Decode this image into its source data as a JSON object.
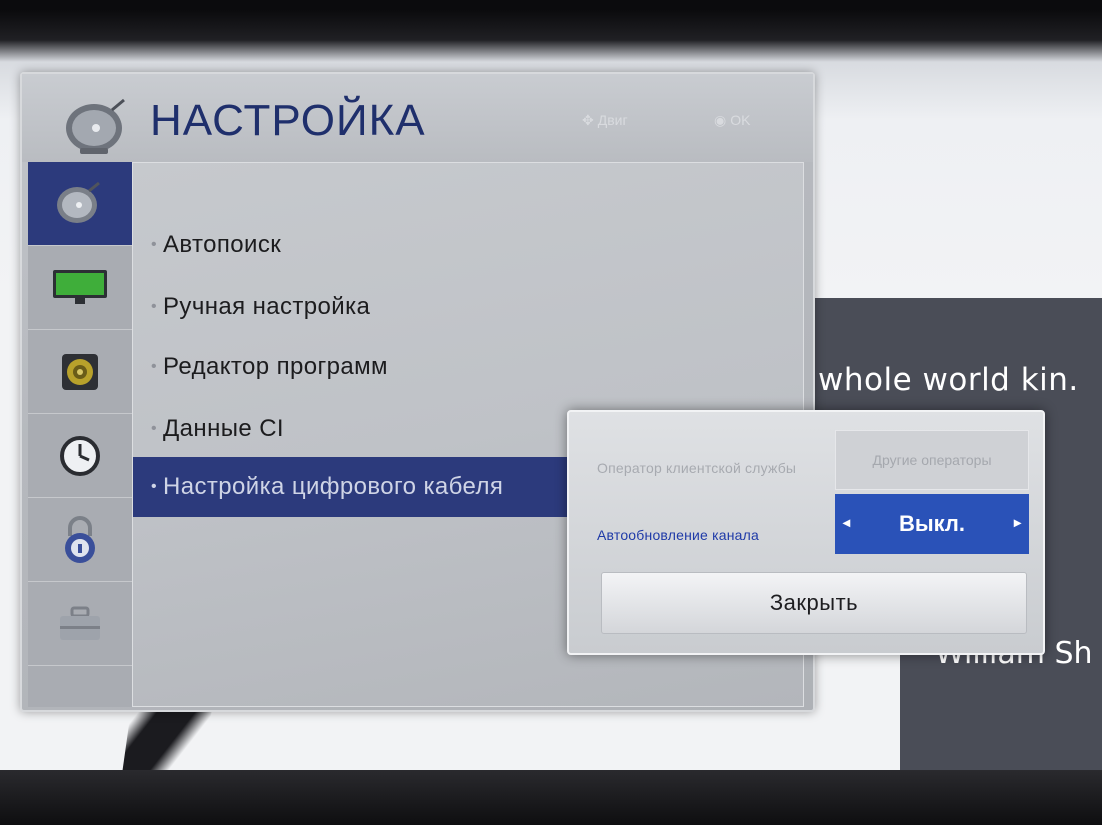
{
  "background": {
    "quote_text": "whole world kin.",
    "author_text": "William Sh"
  },
  "panel": {
    "title": "НАСТРОЙКА",
    "title_icon": "satellite-dish-icon",
    "hints": {
      "move": "Двиг",
      "ok": "OK"
    }
  },
  "sidebar": {
    "items": [
      {
        "icon": "satellite-dish-icon",
        "active": true
      },
      {
        "icon": "monitor-icon",
        "active": false
      },
      {
        "icon": "speaker-icon",
        "active": false
      },
      {
        "icon": "clock-icon",
        "active": false
      },
      {
        "icon": "lock-icon",
        "active": false
      },
      {
        "icon": "briefcase-icon",
        "active": false
      }
    ]
  },
  "menu": {
    "items": [
      {
        "label": "Автопоиск",
        "selected": false
      },
      {
        "label": "Ручная настройка",
        "selected": false
      },
      {
        "label": "Редактор программ",
        "selected": false
      },
      {
        "label": "Данные CI",
        "selected": false
      },
      {
        "label": "Настройка цифрового кабеля",
        "selected": true
      }
    ]
  },
  "popup": {
    "operator_label": "Оператор клиентской службы",
    "operator_value": "Другие операторы",
    "auto_update_label": "Автообновление канала",
    "auto_update_value": "Выкл.",
    "close_label": "Закрыть"
  },
  "colors": {
    "selection_blue": "#2c3a7c",
    "focus_blue": "#2a52b8",
    "title_blue": "#1f2f6c"
  }
}
